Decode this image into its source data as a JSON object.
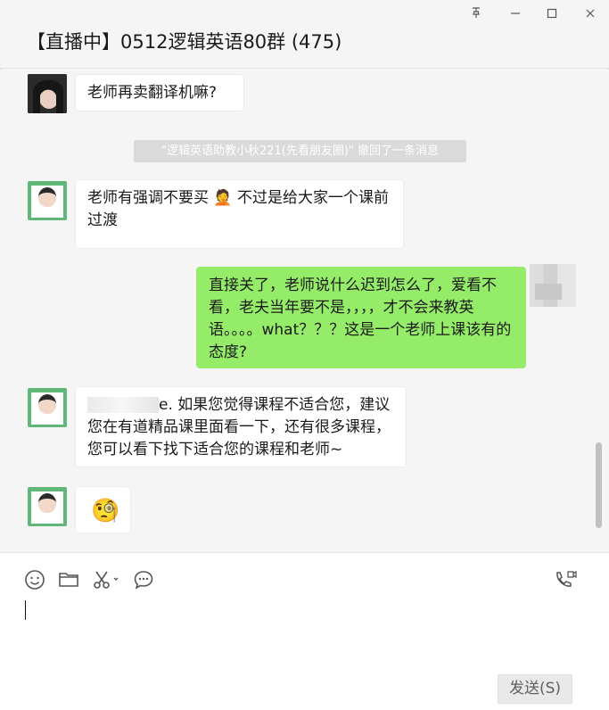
{
  "window": {
    "title": "【直播中】0512逻辑英语80群 (475)",
    "controls": {
      "pin_icon": "pin-icon",
      "minimize_icon": "minimize-icon",
      "maximize_icon": "maximize-icon",
      "close_icon": "close-icon"
    }
  },
  "messages": [
    {
      "sender": "other",
      "text": "老师再卖翻译机嘛?"
    },
    {
      "type": "system",
      "text": "\"逻辑英语助教小秋221(先看朋友圈)\" 撤回了一条消息"
    },
    {
      "sender": "other",
      "text_before": "老师有强调不要买",
      "emoji": "🤦",
      "text_after": "不过是给大家一个课前过渡"
    },
    {
      "sender": "me",
      "text": "直接关了，老师说什么迟到怎么了，爱看不看，老夫当年要不是，，，，才不会来教英语。。。。what？？？这是一个老师上课该有的态度?"
    },
    {
      "sender": "other",
      "text_visible": "e. 如果您觉得课程不适合您，建议您在有道精品课里面看一下，还有很多课程，您可以看下找下适合您的课程和老师~"
    },
    {
      "sender": "other",
      "emoji": "🧐"
    }
  ],
  "input": {
    "tools": [
      "emoji-icon",
      "folder-icon",
      "scissors-icon",
      "chat-history-icon",
      "video-call-icon"
    ],
    "send_label": "发送(S)"
  }
}
